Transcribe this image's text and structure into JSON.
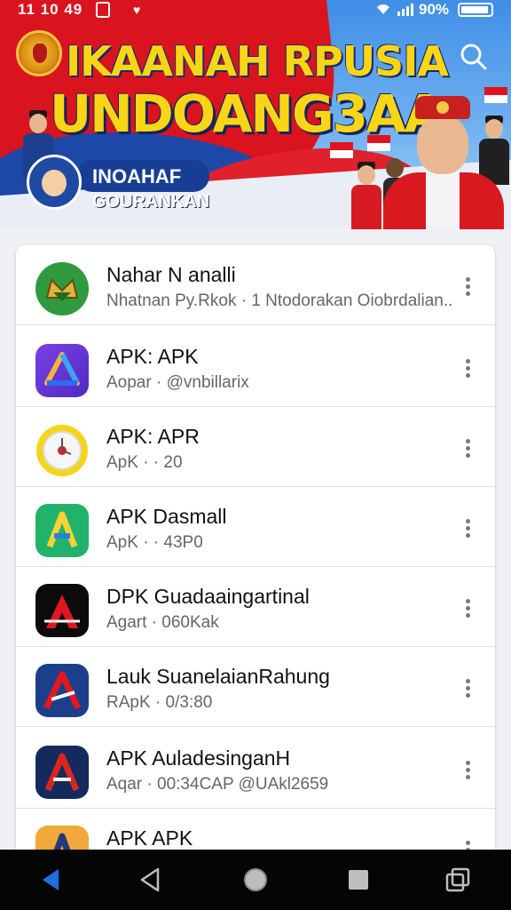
{
  "status_bar": {
    "time": "11 10 49",
    "battery_pct": "90%",
    "icons": [
      "notification-icon",
      "gem-icon",
      "wifi-icon",
      "signal-icon",
      "battery-icon"
    ]
  },
  "banner": {
    "title_line1": "IKAANAH RPUSIA",
    "title_line2": "UNDOANG3AA",
    "pill_top": "INOAHAF",
    "pill_bottom": "GOURANKAN",
    "colors": {
      "red": "#d9141f",
      "blue": "#1d48a8",
      "yellow": "#f9d615"
    }
  },
  "apps": [
    {
      "name": "Nahar N analli",
      "sub": "Nhatnan Py.Rkok · 1 Ntodorakan Oiobrdalian..",
      "icon": "green-gold-emblem-icon"
    },
    {
      "name": "APK: APK",
      "sub": "Aopar · @vnbillarix",
      "icon": "purple-triangle-icon"
    },
    {
      "name": "APK: APR",
      "sub": "ApK · · 20",
      "icon": "yellow-clock-icon"
    },
    {
      "name": "APK Dasmall",
      "sub": "ApK · · 43P0",
      "icon": "green-a-icon"
    },
    {
      "name": "DPK Guadaaingartinal",
      "sub": "Agart · 060Kak",
      "icon": "black-red-a-icon"
    },
    {
      "name": "Lauk SuanelaianRahung",
      "sub": "RApK · 0/3:80",
      "icon": "blue-red-a-icon"
    },
    {
      "name": "APK AuladesinganH",
      "sub": "Aqar · 00:34CAP @UAkl2659",
      "icon": "navy-red-a-icon"
    },
    {
      "name": "APK APK",
      "sub": "",
      "icon": "orange-a-icon"
    }
  ],
  "nav": {
    "icons": [
      "back-arrow-icon",
      "back-triangle-icon",
      "home-circle-icon",
      "recents-square-icon",
      "switch-app-icon"
    ]
  }
}
